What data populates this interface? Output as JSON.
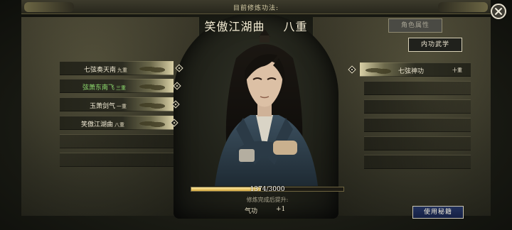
{
  "header": {
    "current_label": "目前修炼功法:",
    "skill_title": "笑傲江湖曲",
    "skill_level": "八重"
  },
  "tabs": {
    "attributes": "角色属性",
    "martial_arts": "内功武学"
  },
  "left_skills": [
    {
      "name": "七弦奏天南",
      "level": "九重",
      "highlight": false
    },
    {
      "name": "弦萧东南飞",
      "level": "三重",
      "highlight": true
    },
    {
      "name": "玉萧剑气",
      "level": "一重",
      "highlight": false
    },
    {
      "name": "笑傲江湖曲",
      "level": "八重",
      "highlight": false
    }
  ],
  "right_skills": [
    {
      "name": "七弦神功",
      "level": "十重"
    }
  ],
  "progress": {
    "text": "1374/3000",
    "current": 1374,
    "max": 3000
  },
  "bonus": {
    "title": "修炼完成后提升:",
    "stat": "气功",
    "value": "+1"
  },
  "buttons": {
    "use_secret_book": "使用秘籍"
  },
  "colors": {
    "highlight_green": "#8fdc6f",
    "use_button": "#1c2a52",
    "progress_gold": "#d4a93f"
  }
}
